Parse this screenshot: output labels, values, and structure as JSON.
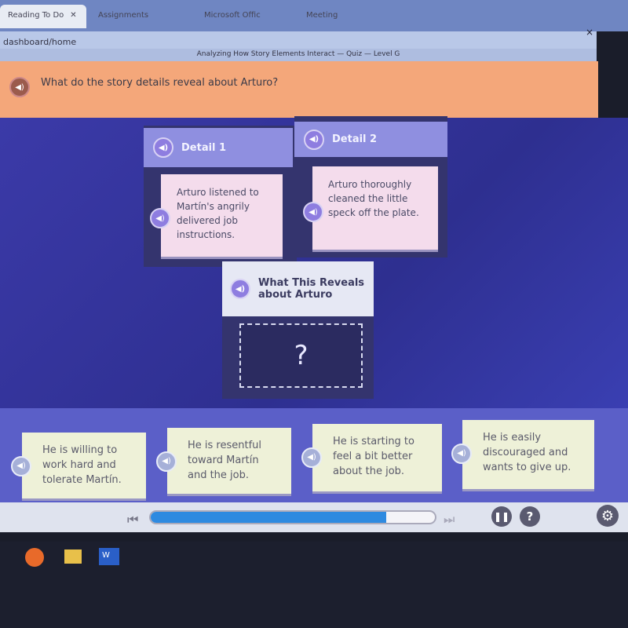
{
  "browser": {
    "tabs": [
      {
        "label": "Reading To Do",
        "active": true
      },
      {
        "label": "Assignments"
      },
      {
        "label": "Microsoft Offic"
      },
      {
        "label": "Meeting"
      }
    ],
    "address": "dashboard/home",
    "page_title": "Analyzing How Story Elements Interact — Quiz — Level G",
    "close": "×"
  },
  "question": "What do the story details reveal about Arturo?",
  "details": [
    {
      "title": "Detail 1",
      "text": "Arturo listened to Martín's angrily delivered job instructions."
    },
    {
      "title": "Detail 2",
      "text": "Arturo thoroughly cleaned the little speck off the plate."
    }
  ],
  "reveal": {
    "title": "What This Reveals about Arturo",
    "placeholder": "?"
  },
  "answers": [
    "He is willing to work hard and tolerate Martín.",
    "He is resentful toward Martín and the job.",
    "He is starting to feel a bit better about the job.",
    "He is easily discouraged and wants to give up."
  ],
  "progress_percent": 83,
  "colors": {
    "accent": "#2e8ae0",
    "question_bar": "#f4a77a",
    "main_bg": "#3b3aa8"
  }
}
